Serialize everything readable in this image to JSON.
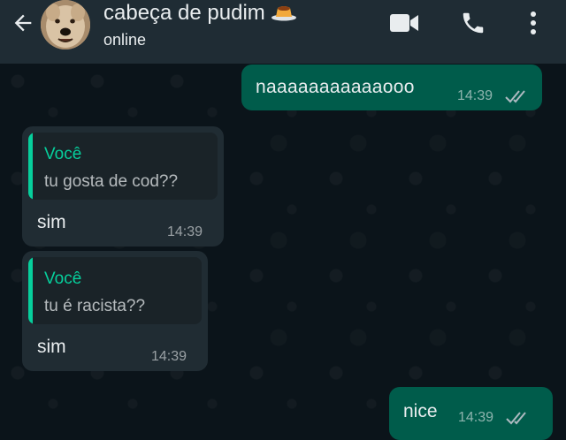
{
  "header": {
    "contact_name": "cabeça de pudim",
    "contact_emoji": "pudim-emoji",
    "status": "online",
    "icons": [
      "back-arrow-icon",
      "video-call-icon",
      "phone-icon",
      "more-vert-icon"
    ]
  },
  "messages": [
    {
      "direction": "outgoing",
      "text": "naaaaaaaaaaaooo",
      "time": "14:39",
      "status": "read"
    },
    {
      "direction": "incoming",
      "quote_author": "Você",
      "quote_text": "tu gosta de cod??",
      "text": "sim",
      "time": "14:39"
    },
    {
      "direction": "incoming",
      "quote_author": "Você",
      "quote_text": "tu é racista??",
      "text": "sim",
      "time": "14:39"
    },
    {
      "direction": "outgoing",
      "text": "nice",
      "time": "14:39",
      "status": "read"
    }
  ],
  "colors": {
    "header_bg": "#1f2c34",
    "chat_bg": "#0b141a",
    "outgoing_bubble": "#005c4b",
    "incoming_bubble": "#202c33",
    "quote_accent": "#06cf9c"
  }
}
